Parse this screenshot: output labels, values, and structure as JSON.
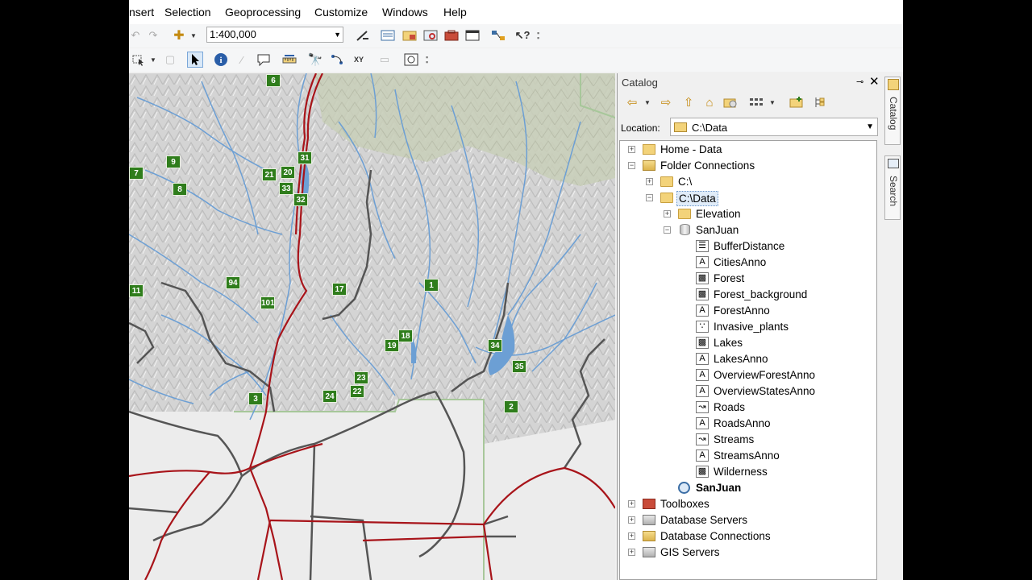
{
  "menubar": {
    "items": [
      "nsert",
      "Selection",
      "Geoprocessing",
      "Customize",
      "Windows",
      "Help"
    ]
  },
  "toolbar": {
    "scale_value": "1:400,000"
  },
  "map": {
    "route_markers": [
      "6",
      "31",
      "9",
      "21",
      "20",
      "33",
      "32",
      "7",
      "8",
      "94",
      "17",
      "1",
      "101",
      "11",
      "18",
      "19",
      "34",
      "35",
      "23",
      "22",
      "24",
      "3",
      "2"
    ]
  },
  "catalog": {
    "title": "Catalog",
    "pin_icon": "pin-icon",
    "close_label": "✕",
    "location_label": "Location:",
    "location_value": "C:\\Data",
    "tree": [
      {
        "label": "Home - Data",
        "icon": "home-folder-icon",
        "expander": "+"
      },
      {
        "label": "Folder Connections",
        "icon": "folder-connections-icon",
        "expander": "−"
      },
      {
        "label": "C:\\",
        "icon": "folder-icon",
        "expander": "+"
      },
      {
        "label": "C:\\Data",
        "icon": "folder-icon",
        "expander": "−"
      },
      {
        "label": "Elevation",
        "icon": "folder-icon",
        "expander": "+"
      },
      {
        "label": "SanJuan",
        "icon": "geodatabase-icon",
        "expander": "−"
      },
      {
        "label": "BufferDistance",
        "icon": "table-icon"
      },
      {
        "label": "CitiesAnno",
        "icon": "annotation-class-icon"
      },
      {
        "label": "Forest",
        "icon": "polygon-class-icon"
      },
      {
        "label": "Forest_background",
        "icon": "polygon-class-icon"
      },
      {
        "label": "ForestAnno",
        "icon": "annotation-class-icon"
      },
      {
        "label": "Invasive_plants",
        "icon": "point-class-icon"
      },
      {
        "label": "Lakes",
        "icon": "polygon-class-icon"
      },
      {
        "label": "LakesAnno",
        "icon": "annotation-class-icon"
      },
      {
        "label": "OverviewForestAnno",
        "icon": "annotation-class-icon"
      },
      {
        "label": "OverviewStatesAnno",
        "icon": "annotation-class-icon"
      },
      {
        "label": "Roads",
        "icon": "line-class-icon"
      },
      {
        "label": "RoadsAnno",
        "icon": "annotation-class-icon"
      },
      {
        "label": "Streams",
        "icon": "line-class-icon"
      },
      {
        "label": "StreamsAnno",
        "icon": "annotation-class-icon"
      },
      {
        "label": "Wilderness",
        "icon": "polygon-class-icon"
      },
      {
        "label": "SanJuan",
        "icon": "map-document-icon"
      },
      {
        "label": "Toolboxes",
        "icon": "toolbox-icon",
        "expander": "+"
      },
      {
        "label": "Database Servers",
        "icon": "database-servers-icon",
        "expander": "+"
      },
      {
        "label": "Database Connections",
        "icon": "database-connections-icon",
        "expander": "+"
      },
      {
        "label": "GIS Servers",
        "icon": "gis-servers-icon",
        "expander": "+"
      }
    ]
  },
  "side_tabs": {
    "catalog": "Catalog",
    "search": "Search"
  },
  "colors": {
    "highway_marker": "#2f7d1c",
    "road_red": "#a8141a",
    "stream_blue": "#6c9fd4",
    "road_gray": "#555555",
    "selection": "#e0ecf9"
  }
}
